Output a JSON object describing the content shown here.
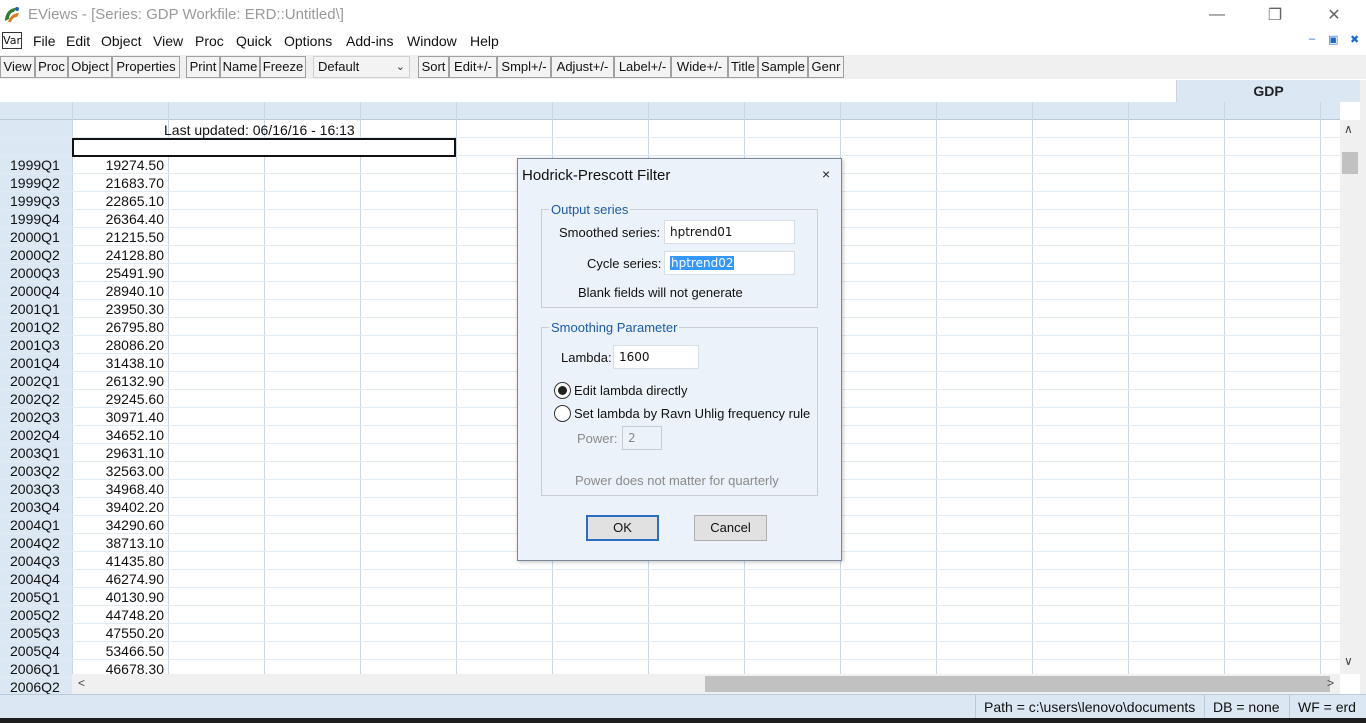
{
  "window": {
    "title": "EViews - [Series: GDP   Workfile: ERD::Untitled\\]",
    "minimize_glyph": "—",
    "maximize_glyph": "❐",
    "close_glyph": "✕"
  },
  "menubar": {
    "var_icon_label": "Var",
    "items": [
      "File",
      "Edit",
      "Object",
      "View",
      "Proc",
      "Quick",
      "Options",
      "Add-ins",
      "Window",
      "Help"
    ],
    "mdi_controls": [
      "–",
      "▣",
      "✖"
    ]
  },
  "toolbar": {
    "buttons_left": [
      "View",
      "Proc",
      "Object",
      "Properties",
      "Print",
      "Name",
      "Freeze"
    ],
    "display_select": "Default",
    "buttons_right": [
      "Sort",
      "Edit+/-",
      "Smpl+/-",
      "Adjust+/-",
      "Label+/-",
      "Wide+/-",
      "Title",
      "Sample",
      "Genr"
    ]
  },
  "sheet": {
    "series_name": "GDP",
    "last_updated": "Last updated: 06/16/16 - 16:13",
    "rows": [
      {
        "label": "1999Q1",
        "value": "19274.50"
      },
      {
        "label": "1999Q2",
        "value": "21683.70"
      },
      {
        "label": "1999Q3",
        "value": "22865.10"
      },
      {
        "label": "1999Q4",
        "value": "26364.40"
      },
      {
        "label": "2000Q1",
        "value": "21215.50"
      },
      {
        "label": "2000Q2",
        "value": "24128.80"
      },
      {
        "label": "2000Q3",
        "value": "25491.90"
      },
      {
        "label": "2000Q4",
        "value": "28940.10"
      },
      {
        "label": "2001Q1",
        "value": "23950.30"
      },
      {
        "label": "2001Q2",
        "value": "26795.80"
      },
      {
        "label": "2001Q3",
        "value": "28086.20"
      },
      {
        "label": "2001Q4",
        "value": "31438.10"
      },
      {
        "label": "2002Q1",
        "value": "26132.90"
      },
      {
        "label": "2002Q2",
        "value": "29245.60"
      },
      {
        "label": "2002Q3",
        "value": "30971.40"
      },
      {
        "label": "2002Q4",
        "value": "34652.10"
      },
      {
        "label": "2003Q1",
        "value": "29631.10"
      },
      {
        "label": "2003Q2",
        "value": "32563.00"
      },
      {
        "label": "2003Q3",
        "value": "34968.40"
      },
      {
        "label": "2003Q4",
        "value": "39402.20"
      },
      {
        "label": "2004Q1",
        "value": "34290.60"
      },
      {
        "label": "2004Q2",
        "value": "38713.10"
      },
      {
        "label": "2004Q3",
        "value": "41435.80"
      },
      {
        "label": "2004Q4",
        "value": "46274.90"
      },
      {
        "label": "2005Q1",
        "value": "40130.90"
      },
      {
        "label": "2005Q2",
        "value": "44748.20"
      },
      {
        "label": "2005Q3",
        "value": "47550.20"
      },
      {
        "label": "2005Q4",
        "value": "53466.50"
      },
      {
        "label": "2006Q1",
        "value": "46678.30"
      },
      {
        "label": "2006Q2",
        "value": ""
      }
    ],
    "scroll_up": "∧",
    "scroll_down": "∨",
    "scroll_left": "<",
    "scroll_right": ">"
  },
  "statusbar": {
    "path": "Path = c:\\users\\lenovo\\documents",
    "db": "DB = none",
    "wf": "WF = erd"
  },
  "dialog": {
    "title": "Hodrick-Prescott Filter",
    "close_glyph": "×",
    "output_group_title": "Output series",
    "smoothed_label": "Smoothed series:",
    "smoothed_value": "hptrend01",
    "cycle_label": "Cycle series:",
    "cycle_value": "hptrend02",
    "blank_note": "Blank fields will not generate",
    "smoothing_group_title": "Smoothing Parameter",
    "lambda_label": "Lambda:",
    "lambda_value": "1600",
    "radio_edit_label": "Edit lambda directly",
    "radio_ravn_label": "Set lambda by Ravn Uhlig frequency rule",
    "power_label": "Power:",
    "power_value": "2",
    "power_note": "Power does not matter for quarterly",
    "ok_label": "OK",
    "cancel_label": "Cancel",
    "selected_rule": "Edit lambda directly"
  },
  "colors": {
    "accent_blue": "#1c5aa8",
    "header_blue": "#dbe8f3",
    "selection": "#3399ff"
  }
}
